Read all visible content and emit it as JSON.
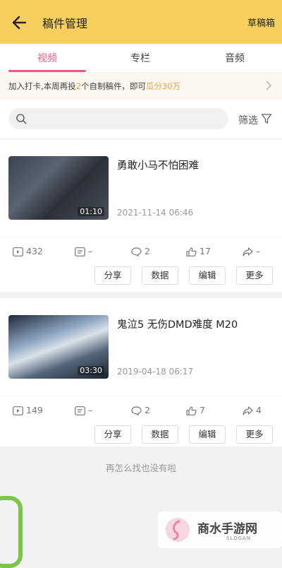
{
  "header": {
    "title": "稿件管理",
    "drafts_label": "草稿箱"
  },
  "tabs": [
    {
      "label": "视频",
      "active": true
    },
    {
      "label": "专栏",
      "active": false
    },
    {
      "label": "音频",
      "active": false
    }
  ],
  "notice": {
    "prefix": "加入打卡,本周再投",
    "count": "2",
    "middle": "个自制稿件，即可",
    "reward": "瓜分30万"
  },
  "search": {
    "filter_label": "筛选"
  },
  "videos": [
    {
      "title": "勇敢小马不怕困难",
      "duration": "01:10",
      "date": "2021-11-14 06:46",
      "stats": {
        "plays": "432",
        "danmaku": "–",
        "comments": "2",
        "likes": "17",
        "shares": "–"
      }
    },
    {
      "title": "鬼泣5 无伤DMD难度 M20",
      "duration": "03:30",
      "date": "2019-04-18 06:17",
      "stats": {
        "plays": "149",
        "danmaku": "–",
        "comments": "2",
        "likes": "7",
        "shares": "4"
      }
    }
  ],
  "actions": {
    "share": "分享",
    "data": "数据",
    "edit": "编辑",
    "more": "更多"
  },
  "footer": {
    "end_text": "再怎么找也没有啦"
  },
  "watermark": {
    "name": "商水手游网",
    "sub": "SLOGAN"
  },
  "colors": {
    "header": "#f7cf5f",
    "accent": "#e65b88",
    "highlight": "#e8a545"
  }
}
